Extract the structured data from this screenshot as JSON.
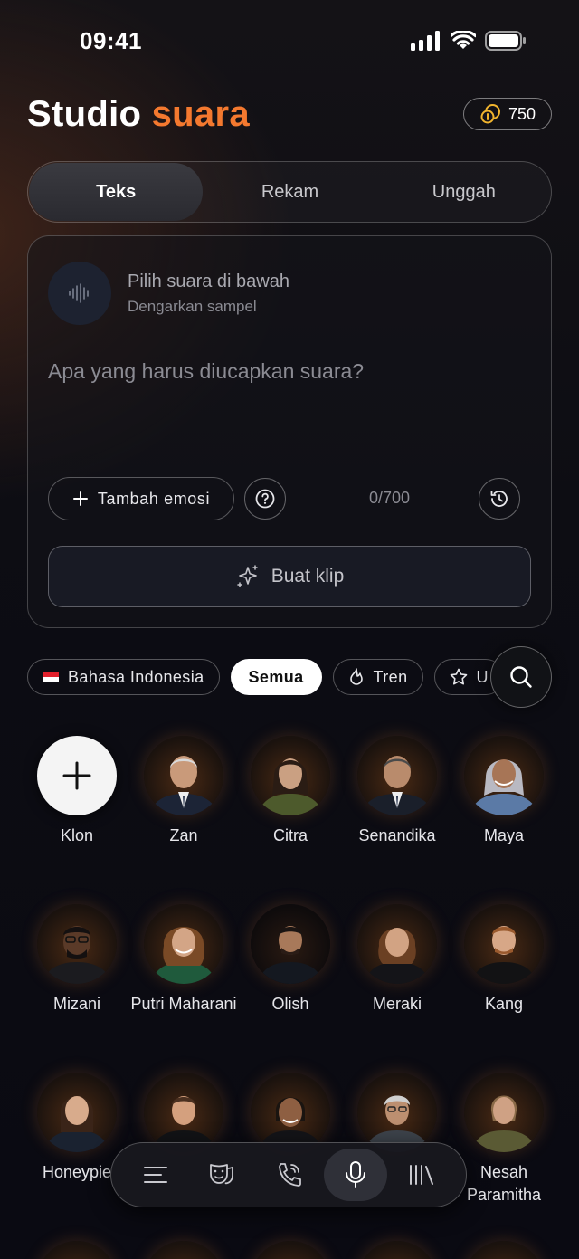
{
  "status": {
    "time": "09:41"
  },
  "header": {
    "title_main": "Studio",
    "title_accent": "suara",
    "credits": "750"
  },
  "tabs": [
    {
      "label": "Teks",
      "active": true
    },
    {
      "label": "Rekam",
      "active": false
    },
    {
      "label": "Unggah",
      "active": false
    }
  ],
  "composer": {
    "voice_title": "Pilih suara di bawah",
    "voice_subtitle": "Dengarkan sampel",
    "placeholder": "Apa yang harus diucapkan suara?",
    "emotion_label": "Tambah emosi",
    "counter": "0/700",
    "create_label": "Buat klip"
  },
  "filters": {
    "language": "Bahasa Indonesia",
    "all": "Semua",
    "trending": "Tren",
    "favorites": "U"
  },
  "voices": [
    {
      "name": "Klon"
    },
    {
      "name": "Zan"
    },
    {
      "name": "Citra"
    },
    {
      "name": "Senandika"
    },
    {
      "name": "Maya"
    },
    {
      "name": "Mizani"
    },
    {
      "name": "Putri Maharani"
    },
    {
      "name": "Olish"
    },
    {
      "name": "Meraki"
    },
    {
      "name": "Kang"
    },
    {
      "name": "Honeypie"
    },
    {
      "name": ""
    },
    {
      "name": ""
    },
    {
      "name": ""
    },
    {
      "name": "Nesah Paramitha"
    }
  ],
  "nav": [
    "menu-icon",
    "masks-icon",
    "phone-icon",
    "mic-icon",
    "library-icon"
  ],
  "colors": {
    "accent": "#f4792f",
    "background": "#0b0b12"
  }
}
